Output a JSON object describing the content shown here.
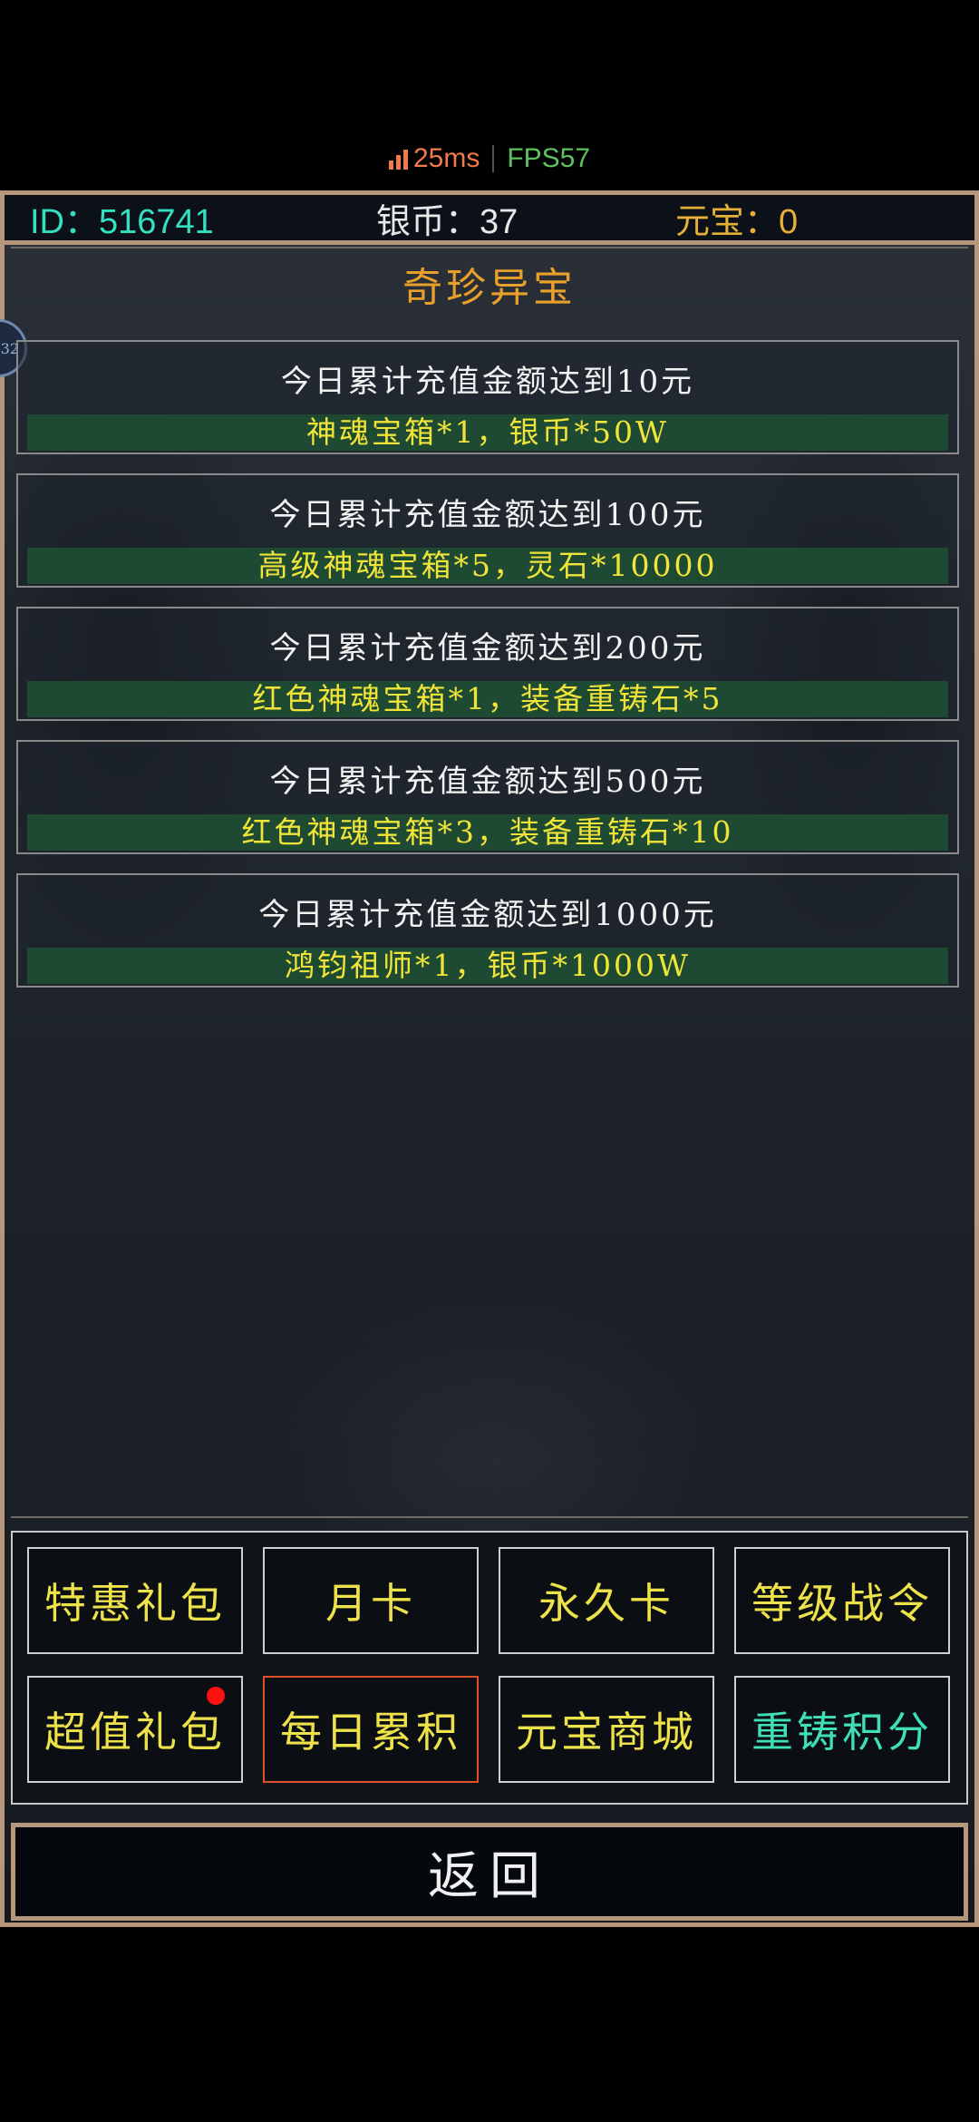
{
  "status": {
    "ping": "25ms",
    "fps": "FPS57"
  },
  "header": {
    "id": "ID：516741",
    "silver": "银币：37",
    "gold": "元宝：0"
  },
  "title": "奇珍异宝",
  "rewards": [
    {
      "condition": "今日累计充值金额达到10元",
      "reward": "神魂宝箱*1，银币*50W"
    },
    {
      "condition": "今日累计充值金额达到100元",
      "reward": "高级神魂宝箱*5，灵石*10000"
    },
    {
      "condition": "今日累计充值金额达到200元",
      "reward": "红色神魂宝箱*1，装备重铸石*5"
    },
    {
      "condition": "今日累计充值金额达到500元",
      "reward": "红色神魂宝箱*3，装备重铸石*10"
    },
    {
      "condition": "今日累计充值金额达到1000元",
      "reward": "鸿钧祖师*1，银币*1000W"
    }
  ],
  "menu": [
    {
      "label": "特惠礼包"
    },
    {
      "label": "月卡"
    },
    {
      "label": "永久卡"
    },
    {
      "label": "等级战令"
    },
    {
      "label": "超值礼包",
      "badge": true
    },
    {
      "label": "每日累积",
      "active": true
    },
    {
      "label": "元宝商城"
    },
    {
      "label": "重铸积分"
    }
  ],
  "back_label": "返回",
  "colors": {
    "frame": "#b6977b",
    "title": "#e8a02a",
    "reward_text": "#f0e438",
    "reward_bg": "#1e4a33",
    "active_border": "#e0502a",
    "id_text": "#33e0c0",
    "gold_text": "#e4b036"
  },
  "icons": [
    "signal-icon",
    "side-bubble-icon",
    "red-dot-badge"
  ]
}
